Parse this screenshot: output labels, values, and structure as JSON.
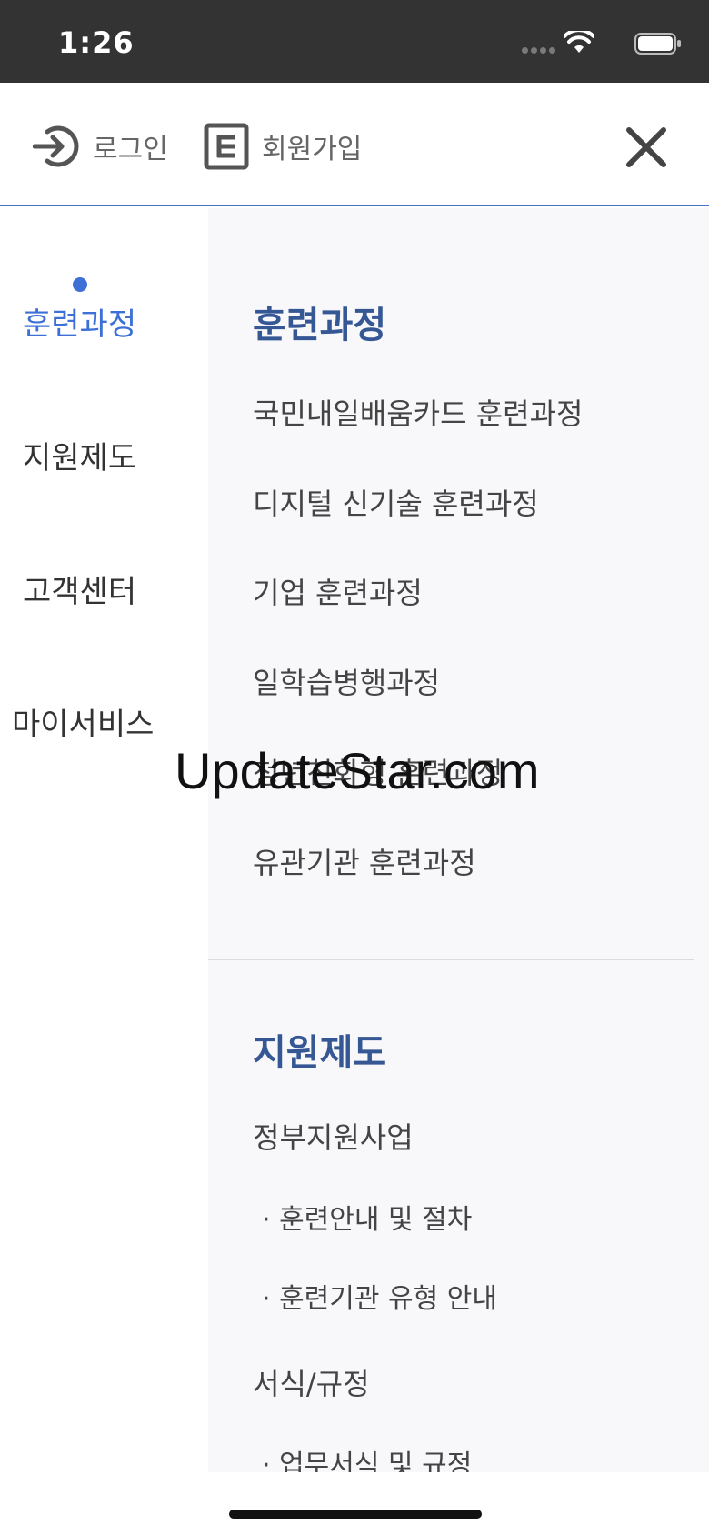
{
  "status_bar": {
    "time": "1:26"
  },
  "top_bar": {
    "login_label": "로그인",
    "signup_label": "회원가입"
  },
  "left_nav": {
    "items": [
      {
        "label": "훈련과정",
        "active": true
      },
      {
        "label": "지원제도",
        "active": false
      },
      {
        "label": "고객센터",
        "active": false
      },
      {
        "label": "마이서비스",
        "active": false
      }
    ]
  },
  "right_panel": {
    "sections": [
      {
        "title": "훈련과정",
        "links": [
          "국민내일배움카드 훈련과정",
          "디지털 신기술 훈련과정",
          "기업 훈련과정",
          "일학습병행과정",
          "청년친화형 훈련과정",
          "유관기관 훈련과정"
        ]
      },
      {
        "title": "지원제도",
        "groups": [
          {
            "label": "정부지원사업",
            "sub": [
              "· 훈련안내 및 절차",
              "· 훈련기관 유형 안내"
            ]
          },
          {
            "label": "서식/규정",
            "sub": [
              "· 업무서식 및 규정"
            ]
          }
        ]
      }
    ]
  },
  "watermark": "UpdateStar.com",
  "colors": {
    "accent": "#3d70d6",
    "section_title": "#355794",
    "status_bar": "#333333",
    "panel_bg": "#f8f8fb"
  }
}
